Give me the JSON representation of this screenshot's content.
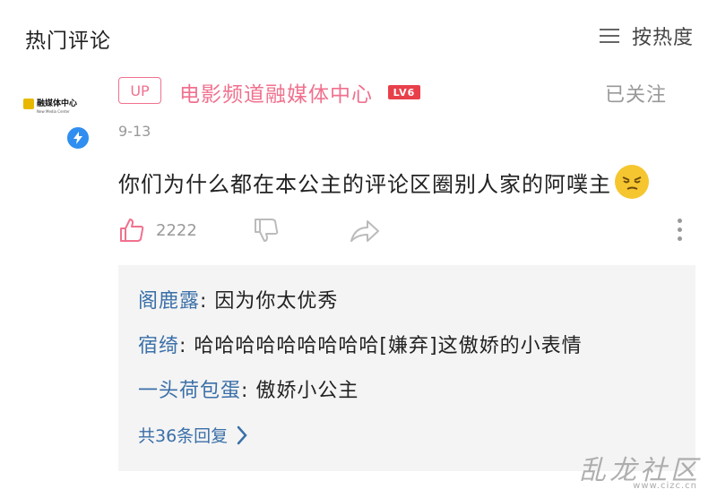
{
  "header": {
    "title": "热门评论",
    "sort_label": "按热度",
    "sort_icon": "menu-lines-icon"
  },
  "comment": {
    "avatar": {
      "name": "融媒体中心",
      "sub": "New Media Center"
    },
    "up_tag": "UP",
    "username": "电影频道融媒体中心",
    "level": "LV6",
    "follow_status": "已关注",
    "date": "9-13",
    "text": "你们为什么都在本公主的评论区圈别人家的阿噗主",
    "emoji": "smirk-emoji-icon",
    "like_count": "2222"
  },
  "replies": [
    {
      "author": "阁鹿露",
      "text": ": 因为你太优秀"
    },
    {
      "author": "宿绮",
      "text": ": 哈哈哈哈哈哈哈哈哈[嫌弃]这傲娇的小表情"
    },
    {
      "author": "一头荷包蛋",
      "text": ": 傲娇小公主"
    }
  ],
  "replies_more": "共36条回复",
  "watermark": {
    "title": "乱龙社区",
    "url": "www.cizc.cn"
  },
  "colors": {
    "accent_pink": "#f0718e",
    "link_blue": "#3a6fa8",
    "level_red": "#e8404a",
    "verify_blue": "#2f8ef0"
  }
}
